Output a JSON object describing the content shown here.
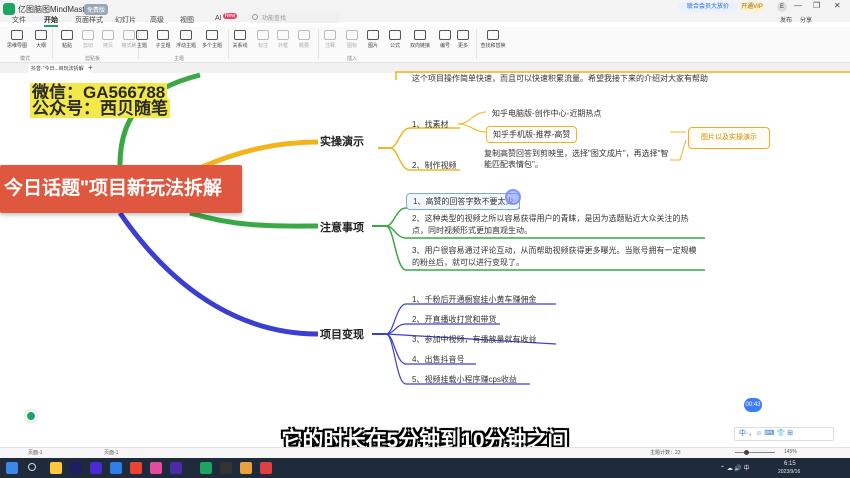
{
  "app": {
    "title": "亿图脑图MindMaster",
    "badge": "免费版",
    "menu": [
      "文件",
      "开始",
      "页面样式",
      "幻灯片",
      "高级",
      "视图",
      "AI"
    ],
    "ai_badge": "New",
    "search_placeholder": "功能查找",
    "vip_label": "联合会员大放价",
    "open_vip": "开通VIP",
    "avatar": "E",
    "window_controls": [
      "—",
      "❐",
      "✕"
    ],
    "right_tools": [
      "发布",
      "分享"
    ]
  },
  "ribbon": {
    "buttons": [
      {
        "label": "思维导图"
      },
      {
        "label": "大纲"
      },
      {
        "label": "粘贴"
      },
      {
        "label": "剪切"
      },
      {
        "label": "拷贝"
      },
      {
        "label": "格式刷"
      },
      {
        "label": "主题"
      },
      {
        "label": "子主题"
      },
      {
        "label": "浮动主题"
      },
      {
        "label": "多个主题"
      },
      {
        "label": "关系线"
      },
      {
        "label": "标注"
      },
      {
        "label": "外框"
      },
      {
        "label": "概要"
      },
      {
        "label": "注释"
      },
      {
        "label": "图标"
      },
      {
        "label": "图片"
      },
      {
        "label": "公式"
      },
      {
        "label": "双向链接"
      },
      {
        "label": "编号"
      },
      {
        "label": "更多"
      },
      {
        "label": "查找和替换"
      }
    ],
    "groups": [
      "模式",
      "剪贴板",
      "主题",
      "插入"
    ]
  },
  "tab": {
    "label": "抖音-\"今日...目玩法拆解"
  },
  "watermark": {
    "line1": "微信：GA566788",
    "line2": "公众号：西贝随笔"
  },
  "mindmap": {
    "root": "今日话题\"项目新玩法拆解",
    "top_text": "这个项目操作简单快速，而且可以快速积累流量。希望我接下来的介绍对大家有帮助",
    "branches": [
      {
        "title": "实操演示",
        "items": [
          {
            "label": "1、找素材",
            "children": [
              "知乎电脑版-创作中心-近期热点",
              "知乎手机版-推荐-高赞"
            ]
          },
          {
            "label": "2、制作视频",
            "detail": "复制高赞回答到剪映里，选择\"图文成片\"，再选择\"智能匹配表情包\"。"
          }
        ],
        "callout": "图片以及实操演示"
      },
      {
        "title": "注意事项",
        "items": [
          "1、高赞的回答字数不要太少",
          "2、这种类型的视频之所以容易获得用户的青睐，是因为选题贴近大众关注的热点，同时视频形式更加直观生动。",
          "3、用户很容易通过评论互动，从而帮助视频获得更多曝光。当账号拥有一定规模的粉丝后，就可以进行变现了。"
        ]
      },
      {
        "title": "项目变现",
        "items": [
          "1、千粉后开通橱窗挂小黄车赚佣金",
          "2、开直播收打赏和带货",
          "3、参加中视频，有播放量就有收益",
          "4、出售抖音号",
          "5、视频挂载小程序赚cps收益"
        ]
      }
    ]
  },
  "subtitle": "它的时长在5分钟到10分钟之间",
  "time_badge": "00:43",
  "ime": "中·，☺ ⌨ 👕 ⊞",
  "statusbar": {
    "page_left": "页面-1",
    "page_tab": "页面-1",
    "topic_count": "主题计数：23",
    "zoom": "145%"
  },
  "taskbar": {
    "time": "6:15",
    "date": "2023/9/16",
    "tray": "⌃ ☁ 🔊 中"
  },
  "colors": {
    "accent": "#1da462",
    "root": "#e0573f",
    "branch_yellow": "#f1b51c",
    "branch_green": "#3aa844",
    "branch_blue": "#3b3fcf",
    "callout": "#f1a928",
    "watermark_bg": "#f3e84a"
  }
}
